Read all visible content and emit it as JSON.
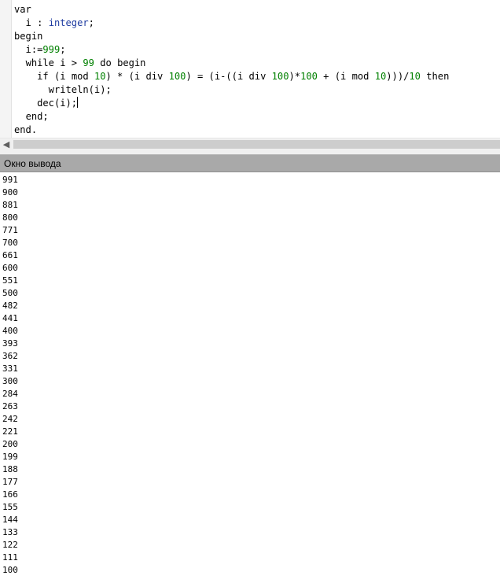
{
  "editor": {
    "lines": [
      [
        {
          "t": "var",
          "c": "kw"
        }
      ],
      [
        {
          "t": "  i : ",
          "c": "txt"
        },
        {
          "t": "integer",
          "c": "ty"
        },
        {
          "t": ";",
          "c": "txt"
        }
      ],
      [
        {
          "t": "begin",
          "c": "kw"
        }
      ],
      [
        {
          "t": "  i:=",
          "c": "txt"
        },
        {
          "t": "999",
          "c": "num"
        },
        {
          "t": ";",
          "c": "txt"
        }
      ],
      [
        {
          "t": "  ",
          "c": "txt"
        },
        {
          "t": "while",
          "c": "kw"
        },
        {
          "t": " i > ",
          "c": "txt"
        },
        {
          "t": "99",
          "c": "num"
        },
        {
          "t": " ",
          "c": "txt"
        },
        {
          "t": "do",
          "c": "kw"
        },
        {
          "t": " ",
          "c": "txt"
        },
        {
          "t": "begin",
          "c": "kw"
        }
      ],
      [
        {
          "t": "    ",
          "c": "txt"
        },
        {
          "t": "if",
          "c": "kw"
        },
        {
          "t": " (i ",
          "c": "txt"
        },
        {
          "t": "mod",
          "c": "kw"
        },
        {
          "t": " ",
          "c": "txt"
        },
        {
          "t": "10",
          "c": "num"
        },
        {
          "t": ") * (i ",
          "c": "txt"
        },
        {
          "t": "div",
          "c": "kw"
        },
        {
          "t": " ",
          "c": "txt"
        },
        {
          "t": "100",
          "c": "num"
        },
        {
          "t": ") = (i-((i ",
          "c": "txt"
        },
        {
          "t": "div",
          "c": "kw"
        },
        {
          "t": " ",
          "c": "txt"
        },
        {
          "t": "100",
          "c": "num"
        },
        {
          "t": ")*",
          "c": "txt"
        },
        {
          "t": "100",
          "c": "num"
        },
        {
          "t": " + (i ",
          "c": "txt"
        },
        {
          "t": "mod",
          "c": "kw"
        },
        {
          "t": " ",
          "c": "txt"
        },
        {
          "t": "10",
          "c": "num"
        },
        {
          "t": ")))/",
          "c": "txt"
        },
        {
          "t": "10",
          "c": "num"
        },
        {
          "t": " ",
          "c": "txt"
        },
        {
          "t": "then",
          "c": "kw"
        }
      ],
      [
        {
          "t": "      writeln(i);",
          "c": "txt"
        }
      ],
      [
        {
          "t": "    dec(i);",
          "c": "txt"
        },
        {
          "t": "",
          "c": "caret"
        }
      ],
      [
        {
          "t": "  ",
          "c": "txt"
        },
        {
          "t": "end",
          "c": "kw"
        },
        {
          "t": ";",
          "c": "txt"
        }
      ],
      [
        {
          "t": "end",
          "c": "kw"
        },
        {
          "t": ".",
          "c": "txt"
        }
      ]
    ],
    "scroll_left_icon": "chevron-left-icon"
  },
  "output_panel": {
    "title": "Окно вывода",
    "lines": [
      "991",
      "900",
      "881",
      "800",
      "771",
      "700",
      "661",
      "600",
      "551",
      "500",
      "482",
      "441",
      "400",
      "393",
      "362",
      "331",
      "300",
      "284",
      "263",
      "242",
      "221",
      "200",
      "199",
      "188",
      "177",
      "166",
      "155",
      "144",
      "133",
      "122",
      "111",
      "100"
    ]
  },
  "colors": {
    "keyword": "#000000",
    "type": "#1d3aa0",
    "number": "#008000",
    "panel_header": "#a9a9a9"
  }
}
